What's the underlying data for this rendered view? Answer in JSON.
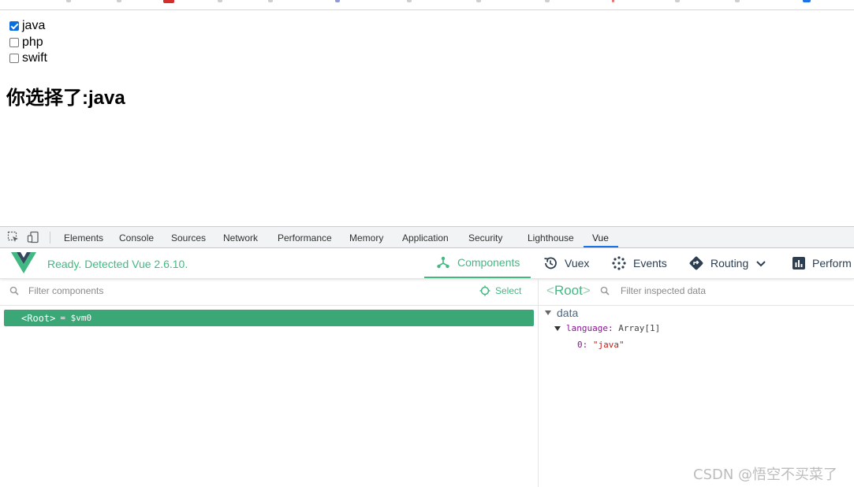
{
  "page": {
    "options": [
      {
        "label": "java",
        "checked": true
      },
      {
        "label": "php",
        "checked": false
      },
      {
        "label": "swift",
        "checked": false
      }
    ],
    "result_text": "你选择了:java"
  },
  "devtools": {
    "tabs": [
      "Elements",
      "Console",
      "Sources",
      "Network",
      "Performance",
      "Memory",
      "Application",
      "Security",
      "Lighthouse",
      "Vue"
    ],
    "active_tab": "Vue"
  },
  "vue_panel": {
    "status": "Ready. Detected Vue 2.6.10.",
    "buttons": {
      "components": "Components",
      "vuex": "Vuex",
      "events": "Events",
      "routing": "Routing",
      "performance": "Perform"
    },
    "accent_color": "#42b983",
    "component_filter_placeholder": "Filter components",
    "select_label": "Select",
    "tree": {
      "root_tag": "<Root>",
      "root_vm": "= $vm0"
    },
    "inspector": {
      "root_label": "Root",
      "filter_placeholder": "Filter inspected data",
      "section": "data",
      "prop_key": "language",
      "prop_value": "Array[1]",
      "item_key": "0",
      "item_value": "\"java\""
    }
  },
  "watermark": "CSDN @悟空不买菜了"
}
